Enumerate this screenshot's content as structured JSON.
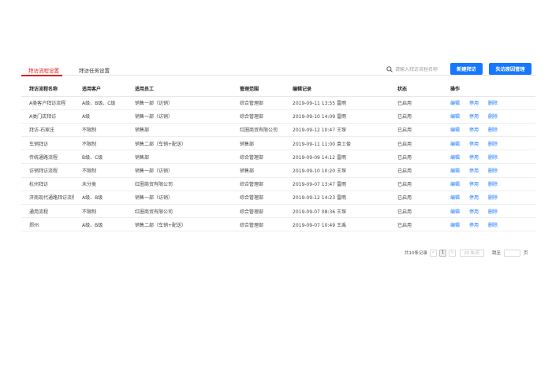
{
  "tabs": [
    {
      "label": "拜访流程设置",
      "active": true
    },
    {
      "label": "拜访任务设置",
      "active": false
    }
  ],
  "search": {
    "placeholder": "请输入拜访流程名称",
    "icon": "search-icon"
  },
  "buttons": {
    "new_label": "新建拜访",
    "reason_label": "失访原因管理"
  },
  "colors": {
    "accent": "#1677ff",
    "tab_active": "#e0201e"
  },
  "table": {
    "headers": [
      "拜访流程名称",
      "适用客户",
      "适用员工",
      "管理范围",
      "编辑记录",
      "状态",
      "操作"
    ],
    "rows": [
      {
        "name": "A类客户拜访流程",
        "customer": "A级、B级、C级",
        "staff": "销售一部（访销）",
        "scope": "综合管理部",
        "record": "2019-09-11 13:55 雷雨",
        "status": "已启用"
      },
      {
        "name": "A类门店拜访",
        "customer": "A级",
        "staff": "销售一部（访销）",
        "scope": "综合管理部",
        "record": "2019-09-10 14:09 雷雨",
        "status": "已启用"
      },
      {
        "name": "拜访-石家庄",
        "customer": "不限制",
        "staff": "销售部",
        "scope": "红圈商贸有限公司",
        "record": "2019-09-12 10:47 王琛",
        "status": "已启用"
      },
      {
        "name": "车销拜访",
        "customer": "不限制",
        "staff": "销售二部（车销+配送）",
        "scope": "销售部",
        "record": "2019-09-11 11:00 袁士俊",
        "status": "已启用"
      },
      {
        "name": "传统通路流程",
        "customer": "B级、C级",
        "staff": "销售部",
        "scope": "综合管理部",
        "record": "2019-09-09 14:12 雷雨",
        "status": "已启用"
      },
      {
        "name": "访销拜访流程",
        "customer": "不限制",
        "staff": "销售一部（访销）",
        "scope": "销售部",
        "record": "2019-09-10 10:20 王琛",
        "status": "已启用"
      },
      {
        "name": "杭州拜访",
        "customer": "未分类",
        "staff": "红圈商贸有限公司",
        "scope": "综合管理部",
        "record": "2019-09-07 13:47 雷雨",
        "status": "已启用"
      },
      {
        "name": "济南现代通路拜访流程",
        "customer": "A级、B级",
        "staff": "销售一部（访销）",
        "scope": "综合管理部",
        "record": "2019-09-12 14:23 雷雨",
        "status": "已启用"
      },
      {
        "name": "通用流程",
        "customer": "不限制",
        "staff": "红圈商贸有限公司",
        "scope": "综合管理部",
        "record": "2019-09-07 08:36 王琛",
        "status": "已启用"
      },
      {
        "name": "郑州",
        "customer": "A级、B级",
        "staff": "销售二部（车销+配送）",
        "scope": "综合管理部",
        "record": "2019-09-07 10:49 王禹",
        "status": "已启用"
      }
    ],
    "actions": [
      "编辑",
      "停用",
      "删除"
    ]
  },
  "pagination": {
    "total": "共10条记录",
    "prev": "<",
    "current": "1",
    "next": ">",
    "page_size": "20 条/页",
    "jump_label": "跳至",
    "page_unit": "页"
  }
}
